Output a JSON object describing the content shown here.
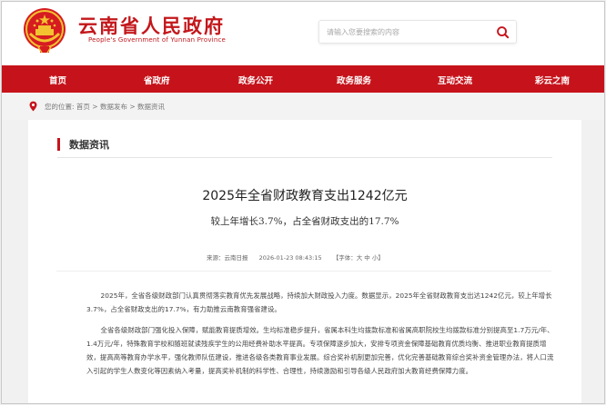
{
  "header": {
    "site_title": "云南省人民政府",
    "site_subtitle": "People's Government of Yunnan Province",
    "search_placeholder": "请输入您要搜索的内容"
  },
  "nav": {
    "items": [
      {
        "label": "首页"
      },
      {
        "label": "省政府"
      },
      {
        "label": "政务公开"
      },
      {
        "label": "政务服务"
      },
      {
        "label": "互动交流"
      },
      {
        "label": "彩云之南"
      }
    ]
  },
  "breadcrumb": {
    "prefix": "您的位置:",
    "items": [
      "首页",
      "数据发布",
      "数据资讯"
    ],
    "separator": " > "
  },
  "section": {
    "title": "数据资讯"
  },
  "article": {
    "title": "2025年全省财政教育支出1242亿元",
    "subtitle": "较上年增长3.7%，占全省财政支出的17.7%",
    "source": "来源：云南日报",
    "datetime": "2026-01-23 08:43:15",
    "font_size_label": "【字体：",
    "font_size_options": [
      "大",
      "中",
      "小"
    ],
    "font_size_close": "】",
    "paragraphs": [
      "2025年，全省各级财政部门认真贯彻落实教育优先发展战略，持续加大财政投入力度。数据显示，2025年全省财政教育支出达1242亿元，较上年增长3.7%，占全省财政支出的17.7%，有力助推云南教育强省建设。",
      "全省各级财政部门强化投入保障，赋能教育提质增效。生均标准稳步提升，省属本科生均拨款标准和省属高职院校生均拨款标准分别提高至1.7万元/年、1.4万元/年，特殊教育学校和随班就读残疾学生的公用经费补助水平提高。专项保障逐步加大，安排专项资金保障基础教育优质均衡、推进职业教育提质增效，提高高等教育办学水平，强化教师队伍建设，推进各级各类教育事业发展。综合奖补机制更加完善，优化完善基础教育综合奖补资金管理办法，将人口流入引起的学生人数变化等因素纳入考量，提高奖补机制的科学性、合理性，持续激励和引导各级人民政府加大教育经费保障力度。"
    ]
  },
  "colors": {
    "brand_red": "#c6131b",
    "title_red": "#c3171b",
    "emblem_gold": "#f2c230"
  }
}
